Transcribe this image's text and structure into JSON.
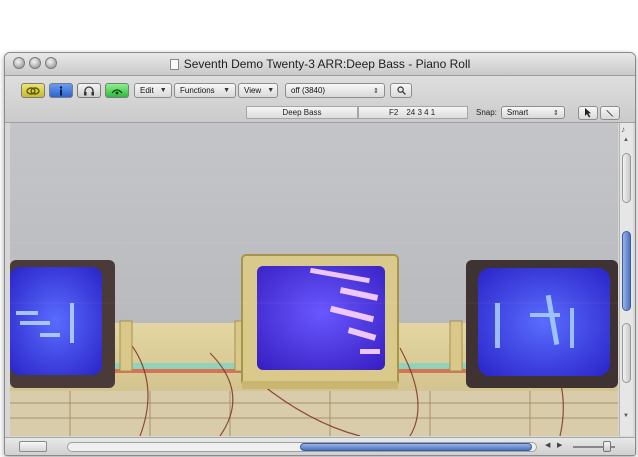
{
  "window": {
    "title": "Seventh Demo Twenty-3 ARR:Deep Bass - Piano Roll"
  },
  "toolbar": {
    "menus": [
      {
        "label": "Edit"
      },
      {
        "label": "Functions"
      },
      {
        "label": "View"
      }
    ],
    "quantize": {
      "value": "off (3840)"
    },
    "region_name": "Deep Bass",
    "note_pitch": "F2",
    "position": "24 3 4 1",
    "snap_label": "Snap:",
    "snap_value": "Smart"
  },
  "colors": {
    "catch_button": "#d9cf3a",
    "link_button": "#2f6fe0",
    "midi_out_button": "#3fcf4a"
  },
  "icons": {
    "catch": "chain-link-icon",
    "link": "info-icon",
    "midi_in": "headphone-icon",
    "midi_out": "midi-out-icon",
    "pointer_tool": "arrow-pointer-icon",
    "pencil_tool": "pencil-icon",
    "search": "magnifier-icon",
    "scroll_arrow_up": "triangle-up-icon",
    "scroll_arrow_down": "triangle-down-icon"
  }
}
